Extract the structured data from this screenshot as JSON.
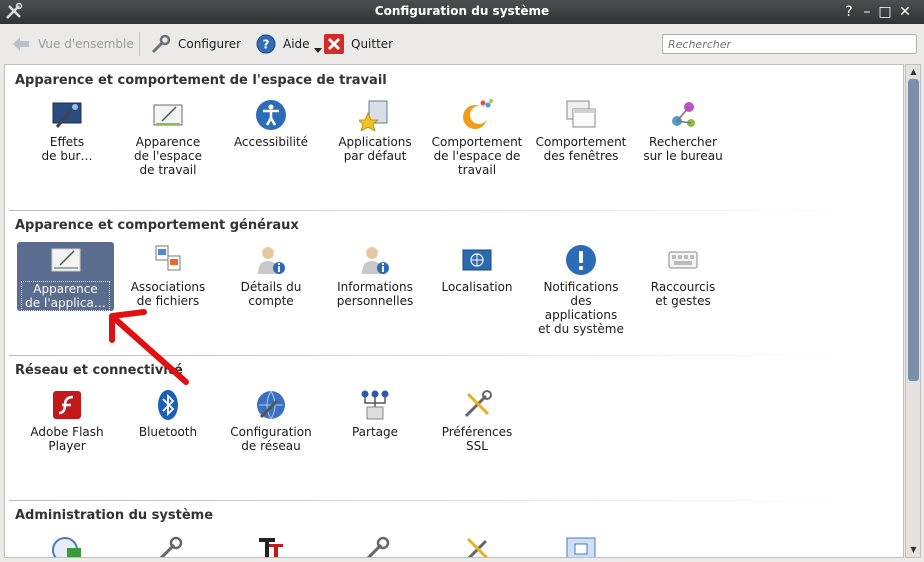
{
  "window": {
    "title": "Configuration du système"
  },
  "toolbar": {
    "overview_label": "Vue d'ensemble",
    "configure_label": "Configurer",
    "help_label": "Aide",
    "quit_label": "Quitter"
  },
  "search": {
    "placeholder": "Rechercher"
  },
  "sections": [
    {
      "title": "Apparence et comportement de l'espace de travail",
      "items": [
        {
          "label": "Effets\nde bur…",
          "icon": "desktop-effects-icon"
        },
        {
          "label": "Apparence\nde l'espace\nde travail",
          "icon": "workspace-appearance-icon"
        },
        {
          "label": "Accessibilité",
          "icon": "accessibility-icon"
        },
        {
          "label": "Applications\npar défaut",
          "icon": "default-applications-icon"
        },
        {
          "label": "Comportement\nde l'espace de\ntravail",
          "icon": "workspace-behavior-icon"
        },
        {
          "label": "Comportement\ndes fenêtres",
          "icon": "window-behavior-icon"
        },
        {
          "label": "Rechercher\nsur le bureau",
          "icon": "desktop-search-icon"
        }
      ]
    },
    {
      "title": "Apparence et comportement généraux",
      "items": [
        {
          "label": "Apparence\nde l'applica…",
          "icon": "application-appearance-icon",
          "selected": true
        },
        {
          "label": "Associations\nde fichiers",
          "icon": "file-associations-icon"
        },
        {
          "label": "Détails du\ncompte",
          "icon": "account-details-icon"
        },
        {
          "label": "Informations\npersonnelles",
          "icon": "personal-information-icon"
        },
        {
          "label": "Localisation",
          "icon": "localization-icon"
        },
        {
          "label": "Notifications\ndes\napplications\net du système",
          "icon": "notifications-icon"
        },
        {
          "label": "Raccourcis\net gestes",
          "icon": "shortcuts-icon"
        }
      ]
    },
    {
      "title": "Réseau et connectivité",
      "items": [
        {
          "label": "Adobe Flash\nPlayer",
          "icon": "flash-icon"
        },
        {
          "label": "Bluetooth",
          "icon": "bluetooth-icon"
        },
        {
          "label": "Configuration\nde réseau",
          "icon": "network-settings-icon"
        },
        {
          "label": "Partage",
          "icon": "sharing-icon"
        },
        {
          "label": "Préférences\nSSL",
          "icon": "ssl-preferences-icon"
        }
      ]
    },
    {
      "title": "Administration du système",
      "items": [
        {
          "label": "",
          "icon": "date-time-icon"
        },
        {
          "label": "",
          "icon": "tools-icon"
        },
        {
          "label": "",
          "icon": "font-installer-icon"
        },
        {
          "label": "",
          "icon": "tools-icon"
        },
        {
          "label": "",
          "icon": "tools-icon"
        },
        {
          "label": "",
          "icon": "login-screen-icon"
        }
      ]
    }
  ]
}
